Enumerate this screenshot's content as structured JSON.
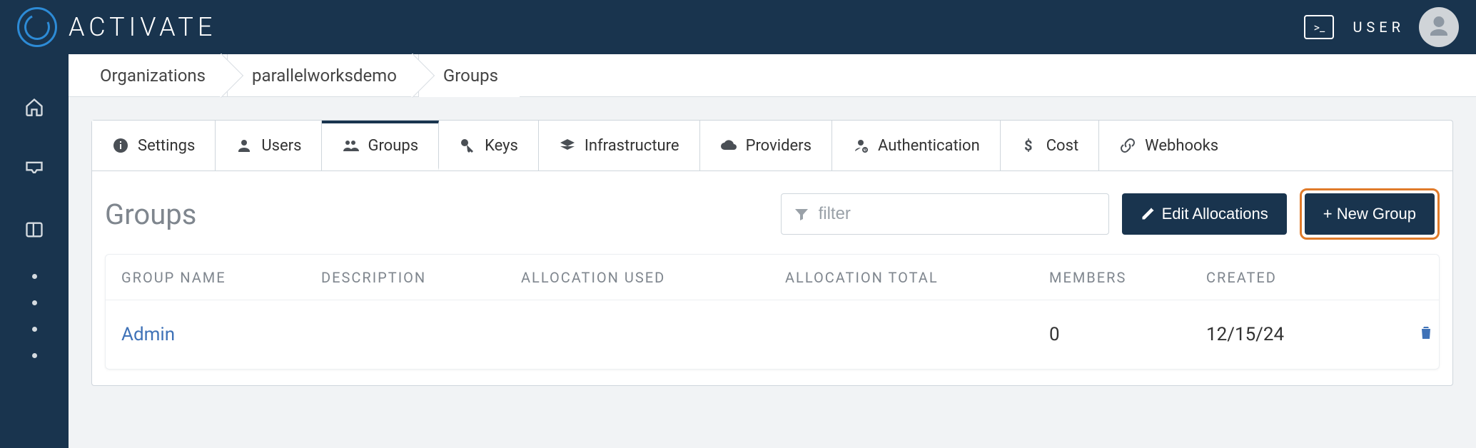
{
  "brand": "ACTIVATE",
  "user_label": "USER",
  "breadcrumbs": [
    "Organizations",
    "parallelworksdemo",
    "Groups"
  ],
  "tabs": [
    {
      "label": "Settings"
    },
    {
      "label": "Users"
    },
    {
      "label": "Groups"
    },
    {
      "label": "Keys"
    },
    {
      "label": "Infrastructure"
    },
    {
      "label": "Providers"
    },
    {
      "label": "Authentication"
    },
    {
      "label": "Cost"
    },
    {
      "label": "Webhooks"
    }
  ],
  "page_title": "Groups",
  "filter_placeholder": "filter",
  "edit_alloc_label": "Edit Allocations",
  "new_group_label": "+ New Group",
  "columns": {
    "group_name": "GROUP NAME",
    "description": "DESCRIPTION",
    "alloc_used": "ALLOCATION USED",
    "alloc_total": "ALLOCATION TOTAL",
    "members": "MEMBERS",
    "created": "CREATED"
  },
  "rows": [
    {
      "group_name": "Admin",
      "description": "",
      "alloc_used": "",
      "alloc_total": "",
      "members": "0",
      "created": "12/15/24"
    }
  ]
}
